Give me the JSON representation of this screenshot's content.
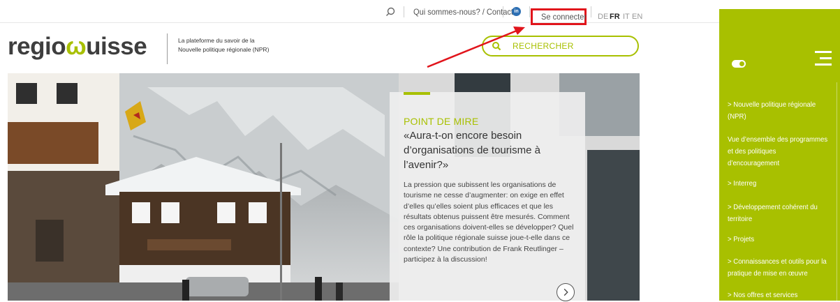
{
  "topbar": {
    "contact_label": "Qui sommes-nous? / Contact",
    "linkedin_label": "in",
    "login_label": "Se connecter",
    "languages": [
      "DE",
      "FR",
      "IT",
      "EN"
    ],
    "active_language": "FR"
  },
  "header": {
    "logo_text_start": "regio",
    "logo_mark": "ω",
    "logo_text_end": "uisse",
    "tagline": "La plateforme du savoir de la Nouvelle politique régionale (NPR)",
    "search_label": "RECHERCHER"
  },
  "hero": {
    "kicker": "POINT DE MIRE",
    "title": "«Aura-t-on encore besoin d’organisations de tourisme à l’avenir?»",
    "body": "La pression que subissent les organisations de tourisme ne cesse d’augmenter: on exige en effet d’elles qu’elles soient plus efficaces et que les résultats obtenus puissent être mesurés. Comment ces organisations doivent-elles se développer? Quel rôle la politique régionale suisse joue-t-elle dans ce contexte? Une contribution de Frank Reutlinger – participez à la discussion!"
  },
  "sidebar": {
    "items": [
      "> Nouvelle politique régionale (NPR)",
      "Vue d’ensemble des programmes et des politiques d’encouragement",
      "> Interreg",
      "> Développement cohérent du territoire",
      "> Projets",
      "> Connaissances et outils pour la pratique de mise en œuvre",
      "> Nos offres et services"
    ]
  },
  "colors": {
    "accent": "#a8c000",
    "annotation": "#e1141b"
  },
  "icons": {
    "search": "search-icon",
    "linkedin": "linkedin-icon",
    "menu": "hamburger-menu-icon",
    "toggle": "toggle-icon",
    "next": "chevron-right-icon"
  }
}
